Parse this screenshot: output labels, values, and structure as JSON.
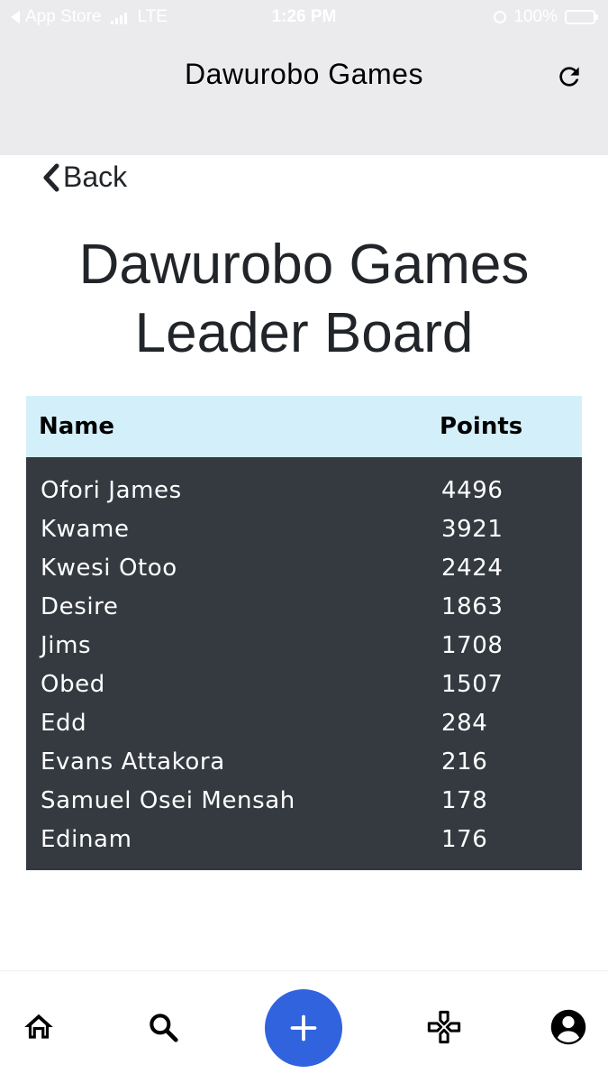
{
  "status_bar": {
    "back_app": "App Store",
    "network": "LTE",
    "time": "1:26 PM",
    "battery": "100%"
  },
  "header": {
    "title": "Dawurobo Games",
    "refresh_icon": "refresh-icon"
  },
  "back_label": "Back",
  "page_title": [
    "Dawurobo Games",
    "Leader Board"
  ],
  "table": {
    "columns": [
      "Name",
      "Points"
    ],
    "rows": [
      {
        "name": "Ofori James",
        "points": "4496"
      },
      {
        "name": "Kwame",
        "points": "3921"
      },
      {
        "name": "Kwesi Otoo",
        "points": "2424"
      },
      {
        "name": "Desire",
        "points": "1863"
      },
      {
        "name": "Jims",
        "points": "1708"
      },
      {
        "name": "Obed",
        "points": "1507"
      },
      {
        "name": "Edd",
        "points": "284"
      },
      {
        "name": "Evans Attakora",
        "points": "216"
      },
      {
        "name": "Samuel Osei Mensah",
        "points": "178"
      },
      {
        "name": "Edinam",
        "points": "176"
      }
    ]
  },
  "tabbar": {
    "items": [
      "home-icon",
      "search-icon",
      "add-icon",
      "gamepad-icon",
      "account-icon"
    ]
  },
  "colors": {
    "header_bg": "#ebebed",
    "table_head_bg": "#d3f0fa",
    "table_body_bg": "#343a40",
    "fab_bg": "#3263de"
  }
}
